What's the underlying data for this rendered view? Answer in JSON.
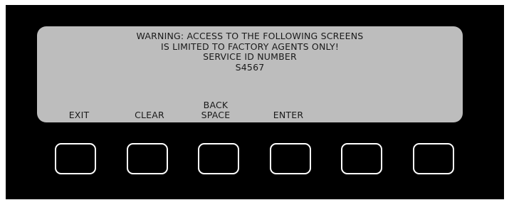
{
  "display": {
    "message_lines": [
      "WARNING: ACCESS TO THE FOLLOWING SCREENS",
      "IS LIMITED TO FACTORY AGENTS ONLY!",
      "SERVICE ID NUMBER",
      "S4567"
    ]
  },
  "softkeys": [
    {
      "line1": "",
      "line2": "EXIT"
    },
    {
      "line1": "",
      "line2": "CLEAR"
    },
    {
      "line1": "BACK",
      "line2": "SPACE"
    },
    {
      "line1": "",
      "line2": "ENTER"
    },
    {
      "line1": "",
      "line2": ""
    },
    {
      "line1": "",
      "line2": ""
    }
  ],
  "colors": {
    "bezel": "#000000",
    "lcd_background": "#bdbdbd",
    "lcd_text": "#1a1a1a",
    "button_outline": "#ffffff"
  }
}
